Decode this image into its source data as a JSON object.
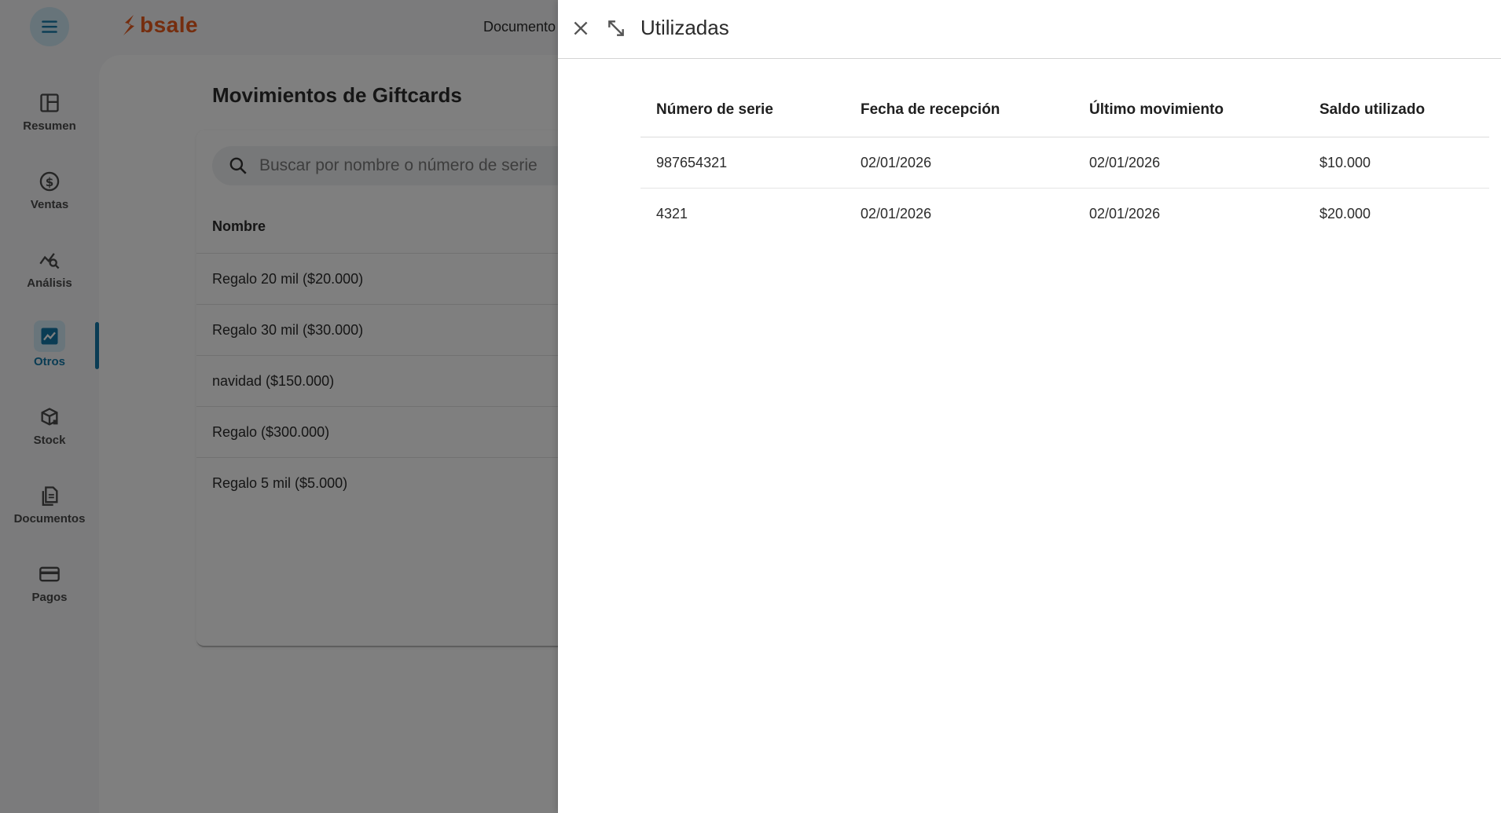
{
  "app": {
    "logo_text": "bsale",
    "top_link": "Documento",
    "menu_icon": "hamburger-menu-icon",
    "brand_color": "#ea5a1c",
    "accent_color": "#1478a8"
  },
  "sidebar": {
    "items": [
      {
        "label": "Resumen",
        "icon": "dashboard-icon"
      },
      {
        "label": "Ventas",
        "icon": "dollar-circle-icon"
      },
      {
        "label": "Análisis",
        "icon": "analytics-search-icon"
      },
      {
        "label": "Otros",
        "icon": "trending-chart-icon",
        "active": true
      },
      {
        "label": "Stock",
        "icon": "box-icon"
      },
      {
        "label": "Documentos",
        "icon": "documents-icon"
      },
      {
        "label": "Pagos",
        "icon": "credit-card-icon"
      }
    ]
  },
  "page": {
    "title": "Movimientos de Giftcards",
    "search_placeholder": "Buscar por nombre o número de serie",
    "column_header": "Nombre",
    "giftcards": [
      "Regalo 20 mil ($20.000)",
      "Regalo 30 mil ($30.000)",
      "navidad ($150.000)",
      "Regalo ($300.000)",
      "Regalo 5 mil ($5.000)"
    ]
  },
  "drawer": {
    "title": "Utilizadas",
    "close_icon": "close-icon",
    "expand_icon": "expand-icon",
    "columns": [
      "Número de serie",
      "Fecha de recepción",
      "Último movimiento",
      "Saldo utilizado"
    ],
    "rows": [
      [
        "987654321",
        "02/01/2026",
        "02/01/2026",
        "$10.000"
      ],
      [
        "4321",
        "02/01/2026",
        "02/01/2026",
        "$20.000"
      ]
    ]
  }
}
